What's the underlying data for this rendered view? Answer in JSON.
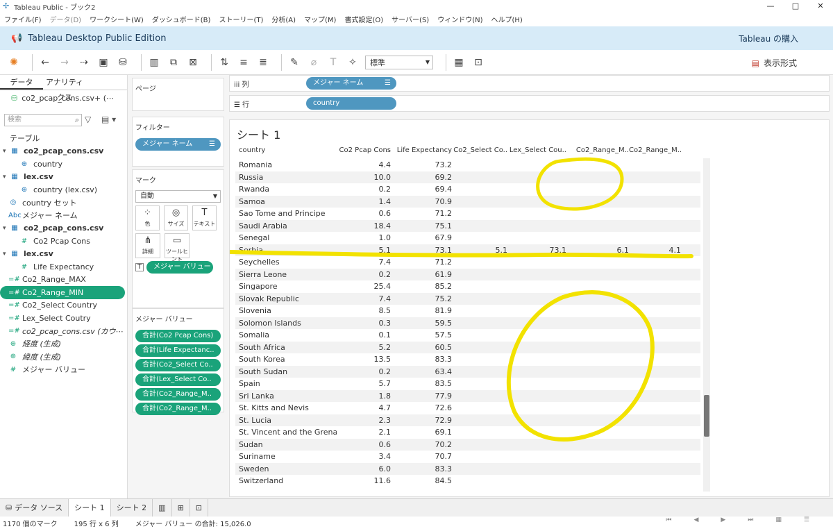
{
  "window": {
    "title": "Tableau Public - ブック2"
  },
  "menu": [
    "ファイル(F)",
    "データ(D)",
    "ワークシート(W)",
    "ダッシュボード(B)",
    "ストーリー(T)",
    "分析(A)",
    "マップ(M)",
    "書式設定(O)",
    "サーバー(S)",
    "ウィンドウ(N)",
    "ヘルプ(H)"
  ],
  "banner": {
    "title": "Tableau Desktop Public Edition",
    "buy": "Tableau の購入"
  },
  "toolbar": {
    "fit": "標準",
    "show_me": "表示形式"
  },
  "datapane": {
    "tabs": [
      "データ",
      "アナリティクス"
    ],
    "source": "co2_pcap_cons.csv+ (⋯",
    "search_placeholder": "検索",
    "section": "テーブル",
    "fields": [
      {
        "label": "co2_pcap_cons.csv",
        "type": "table"
      },
      {
        "label": "country",
        "type": "dim-geo"
      },
      {
        "label": "lex.csv",
        "type": "table"
      },
      {
        "label": "country (lex.csv)",
        "type": "dim-geo"
      },
      {
        "label": "country セット",
        "type": "set"
      },
      {
        "label": "メジャー ネーム",
        "type": "abc"
      },
      {
        "label": "co2_pcap_cons.csv",
        "type": "table"
      },
      {
        "label": "Co2 Pcap Cons",
        "type": "measure"
      },
      {
        "label": "lex.csv",
        "type": "table"
      },
      {
        "label": "Life Expectancy",
        "type": "measure"
      },
      {
        "label": "Co2_Range_MAX",
        "type": "param"
      },
      {
        "label": "Co2_Range_MIN",
        "type": "param-sel"
      },
      {
        "label": "Co2_Select Country",
        "type": "param"
      },
      {
        "label": "Lex_Select Coutry",
        "type": "param"
      },
      {
        "label": "co2_pcap_cons.csv (カウ⋯",
        "type": "count"
      },
      {
        "label": "経度 (生成)",
        "type": "geo"
      },
      {
        "label": "緯度 (生成)",
        "type": "geo"
      },
      {
        "label": "メジャー バリュー",
        "type": "measure"
      }
    ]
  },
  "shelves": {
    "pages": "ページ",
    "filters": "フィルター",
    "filter_pill": "メジャー ネーム",
    "marks": "マーク",
    "mark_type": "自動",
    "mark_buttons": [
      "色",
      "サイズ",
      "テキスト",
      "詳細",
      "ツールヒント"
    ],
    "text_pill": "メジャー バリュー",
    "measure_values_title": "メジャー バリュー",
    "measure_values": [
      "合計(Co2 Pcap Cons)",
      "合計(Life Expectanc..",
      "合計(Co2_Select Co..",
      "合計(Lex_Select Co..",
      "合計(Co2_Range_M..",
      "合計(Co2_Range_M.."
    ]
  },
  "columns_shelf": {
    "label": "列",
    "pill": "メジャー ネーム"
  },
  "rows_shelf": {
    "label": "行",
    "pill": "country"
  },
  "sheet": {
    "title": "シート 1",
    "headers": [
      "country",
      "Co2 Pcap Cons",
      "Life Expectancy",
      "Co2_Select Co..",
      "Lex_Select Cou..",
      "Co2_Range_M..",
      "Co2_Range_M.."
    ],
    "rows": [
      [
        "Romania",
        "4.4",
        "73.2",
        "",
        "",
        "",
        ""
      ],
      [
        "Russia",
        "10.0",
        "69.2",
        "",
        "",
        "",
        ""
      ],
      [
        "Rwanda",
        "0.2",
        "69.4",
        "",
        "",
        "",
        ""
      ],
      [
        "Samoa",
        "1.4",
        "70.9",
        "",
        "",
        "",
        ""
      ],
      [
        "Sao Tome and Principe",
        "0.6",
        "71.2",
        "",
        "",
        "",
        ""
      ],
      [
        "Saudi Arabia",
        "18.4",
        "75.1",
        "",
        "",
        "",
        ""
      ],
      [
        "Senegal",
        "1.0",
        "67.9",
        "",
        "",
        "",
        ""
      ],
      [
        "Serbia",
        "5.1",
        "73.1",
        "5.1",
        "73.1",
        "6.1",
        "4.1"
      ],
      [
        "Seychelles",
        "7.4",
        "71.2",
        "",
        "",
        "",
        ""
      ],
      [
        "Sierra Leone",
        "0.2",
        "61.9",
        "",
        "",
        "",
        ""
      ],
      [
        "Singapore",
        "25.4",
        "85.2",
        "",
        "",
        "",
        ""
      ],
      [
        "Slovak Republic",
        "7.4",
        "75.2",
        "",
        "",
        "",
        ""
      ],
      [
        "Slovenia",
        "8.5",
        "81.9",
        "",
        "",
        "",
        ""
      ],
      [
        "Solomon Islands",
        "0.3",
        "59.5",
        "",
        "",
        "",
        ""
      ],
      [
        "Somalia",
        "0.1",
        "57.5",
        "",
        "",
        "",
        ""
      ],
      [
        "South Africa",
        "5.2",
        "60.5",
        "",
        "",
        "",
        ""
      ],
      [
        "South Korea",
        "13.5",
        "83.3",
        "",
        "",
        "",
        ""
      ],
      [
        "South Sudan",
        "0.2",
        "63.4",
        "",
        "",
        "",
        ""
      ],
      [
        "Spain",
        "5.7",
        "83.5",
        "",
        "",
        "",
        ""
      ],
      [
        "Sri Lanka",
        "1.8",
        "77.9",
        "",
        "",
        "",
        ""
      ],
      [
        "St. Kitts and Nevis",
        "4.7",
        "72.6",
        "",
        "",
        "",
        ""
      ],
      [
        "St. Lucia",
        "2.3",
        "72.9",
        "",
        "",
        "",
        ""
      ],
      [
        "St. Vincent and the Grena..",
        "2.1",
        "69.1",
        "",
        "",
        "",
        ""
      ],
      [
        "Sudan",
        "0.6",
        "70.2",
        "",
        "",
        "",
        ""
      ],
      [
        "Suriname",
        "3.4",
        "70.7",
        "",
        "",
        "",
        ""
      ],
      [
        "Sweden",
        "6.0",
        "83.3",
        "",
        "",
        "",
        ""
      ],
      [
        "Switzerland",
        "11.6",
        "84.5",
        "",
        "",
        "",
        ""
      ]
    ]
  },
  "sheet_tabs": [
    "データ ソース",
    "シート 1",
    "シート 2"
  ],
  "status": {
    "marks": "1170 個のマーク",
    "rows_cols": "195 行 x 6 列",
    "sum": "メジャー バリュー の合計: 15,026.0"
  },
  "colors": {
    "dim_pill": "#4f97c0",
    "measure_pill": "#1aa37a",
    "annotation": "#f2e200",
    "banner": "#d7ebf8"
  }
}
